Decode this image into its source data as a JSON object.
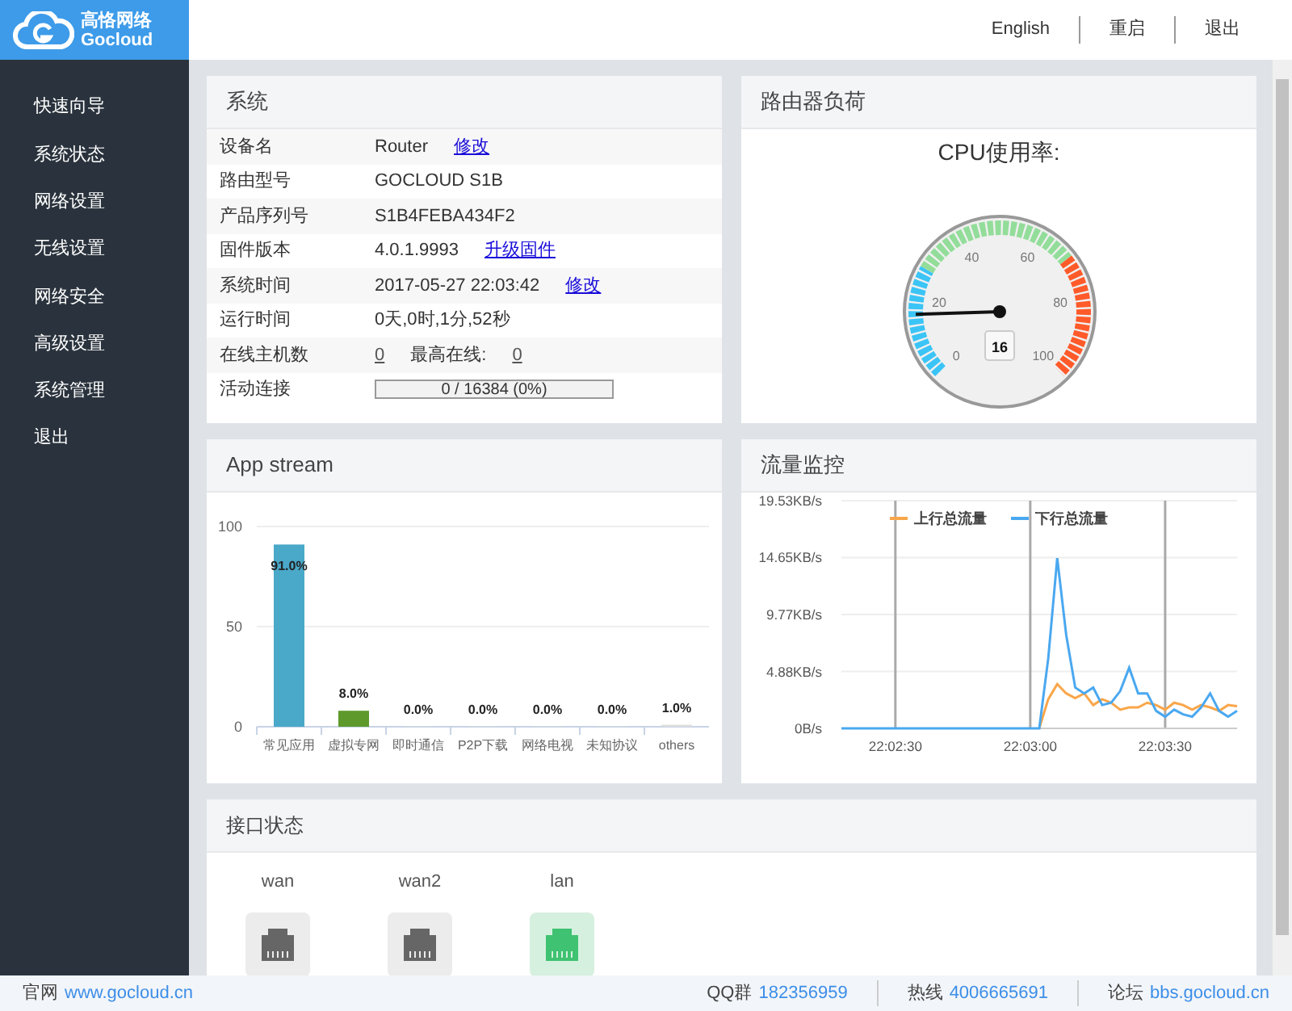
{
  "logo": {
    "title": "高恪网络",
    "subtitle": "Gocloud"
  },
  "header_links": [
    "English",
    "重启",
    "退出"
  ],
  "sidebar": {
    "items": [
      "快速向导",
      "系统状态",
      "网络设置",
      "无线设置",
      "网络安全",
      "高级设置",
      "系统管理",
      "退出"
    ]
  },
  "system": {
    "title": "系统",
    "rows": [
      {
        "kind": "text",
        "label": "设备名",
        "parts": [
          {
            "text": "Router",
            "kind": "text"
          },
          {
            "text": "修改",
            "kind": "link"
          }
        ]
      },
      {
        "kind": "text",
        "label": "路由型号",
        "parts": [
          {
            "text": "GOCLOUD S1B",
            "kind": "text"
          }
        ]
      },
      {
        "kind": "text",
        "label": "产品序列号",
        "parts": [
          {
            "text": "S1B4FEBA434F2",
            "kind": "text"
          }
        ]
      },
      {
        "kind": "text",
        "label": "固件版本",
        "parts": [
          {
            "text": "4.0.1.9993",
            "kind": "text"
          },
          {
            "text": "升级固件",
            "kind": "link"
          }
        ]
      },
      {
        "kind": "text",
        "label": "系统时间",
        "parts": [
          {
            "text": "2017-05-27 22:03:42",
            "kind": "text"
          },
          {
            "text": "修改",
            "kind": "link"
          }
        ]
      },
      {
        "kind": "text",
        "label": "运行时间",
        "parts": [
          {
            "text": "0天,0时,1分,52秒",
            "kind": "text"
          }
        ]
      },
      {
        "kind": "text",
        "label": "在线主机数",
        "parts": [
          {
            "text": "0",
            "kind": "count"
          },
          {
            "text": "最高在线:",
            "kind": "text"
          },
          {
            "text": "0",
            "kind": "count"
          }
        ]
      },
      {
        "kind": "progress",
        "label": "活动连接",
        "text": "0 / 16384 (0%)",
        "level": 0
      }
    ]
  },
  "router_load": {
    "title": "路由器负荷",
    "gauge_title": "CPU使用率:",
    "value": "16",
    "ticks": [
      "0",
      "20",
      "40",
      "60",
      "80",
      "100"
    ]
  },
  "app_stream": {
    "title": "App stream",
    "chart_data": {
      "type": "bar",
      "categories": [
        "常见应用",
        "虚拟专网",
        "即时通信",
        "P2P下载",
        "网络电视",
        "未知协议",
        "others"
      ],
      "values": [
        91.0,
        8.0,
        0.0,
        0.0,
        0.0,
        0.0,
        1.0
      ],
      "colors": [
        "#4aa8c9",
        "#5d9a2b",
        "#cfd8dc",
        "#cfd8dc",
        "#cfd8dc",
        "#cfd8dc",
        "#dddddd"
      ],
      "value_labels": [
        "91.0%",
        "8.0%",
        "0.0%",
        "0.0%",
        "0.0%",
        "0.0%",
        "1.0%"
      ],
      "ylim": [
        0,
        100
      ],
      "yticks": [
        0,
        50,
        100
      ]
    }
  },
  "traffic": {
    "title": "流量监控",
    "chart_data": {
      "type": "line",
      "ylim": [
        0,
        19.53
      ],
      "grid": true,
      "legend": true,
      "categories": [
        null,
        null,
        null,
        null,
        null,
        null,
        "22:02:30",
        null,
        null,
        null,
        null,
        null,
        null,
        null,
        null,
        null,
        null,
        null,
        null,
        null,
        null,
        "22:03:00",
        null,
        null,
        null,
        null,
        null,
        null,
        null,
        null,
        null,
        null,
        null,
        null,
        null,
        null,
        "22:03:30",
        null,
        null,
        null,
        null,
        null,
        null,
        null,
        null
      ],
      "series": [
        {
          "name": "上行总流量",
          "color": "#f9a64a",
          "values": [
            null,
            null,
            null,
            null,
            null,
            null,
            null,
            null,
            null,
            null,
            null,
            null,
            null,
            null,
            null,
            null,
            null,
            null,
            null,
            null,
            null,
            null,
            0,
            2.5,
            3.8,
            3.0,
            2.6,
            3.0,
            2.0,
            2.5,
            2.2,
            1.6,
            1.8,
            1.8,
            2.2,
            2.0,
            1.6,
            2.2,
            2.0,
            1.6,
            2.0,
            1.8,
            1.5,
            2.0,
            1.9
          ]
        },
        {
          "name": "下行总流量",
          "color": "#4aa8f0",
          "values": [
            0,
            0,
            0,
            0,
            0,
            0,
            0,
            0,
            0,
            0,
            0,
            0,
            0,
            0,
            0,
            0,
            0,
            0,
            0,
            0,
            0,
            0,
            0,
            6.0,
            14.6,
            8.0,
            3.5,
            3.0,
            3.5,
            2.0,
            2.2,
            3.2,
            5.2,
            3.0,
            3.0,
            1.5,
            1.0,
            1.6,
            1.2,
            1.0,
            1.8,
            3.0,
            1.5,
            1.0,
            1.5
          ]
        }
      ],
      "yticks": [
        {
          "value": 0,
          "label": "0B/s"
        },
        {
          "value": 4.88,
          "label": "4.88KB/s"
        },
        {
          "value": 9.77,
          "label": "9.77KB/s"
        },
        {
          "value": 14.65,
          "label": "14.65KB/s"
        },
        {
          "value": 19.53,
          "label": "19.53KB/s"
        }
      ]
    }
  },
  "interfaces": {
    "title": "接口状态",
    "ports": [
      {
        "name": "wan",
        "connected": false
      },
      {
        "name": "wan2",
        "connected": false
      },
      {
        "name": "lan",
        "connected": true
      }
    ]
  },
  "footer": {
    "site_label": "官网",
    "site": "www.gocloud.cn",
    "qq_label": "QQ群",
    "qq": "182356959",
    "hotline_label": "热线",
    "hotline": "4006665691",
    "forum_label": "论坛",
    "forum": "bbs.gocloud.cn"
  }
}
